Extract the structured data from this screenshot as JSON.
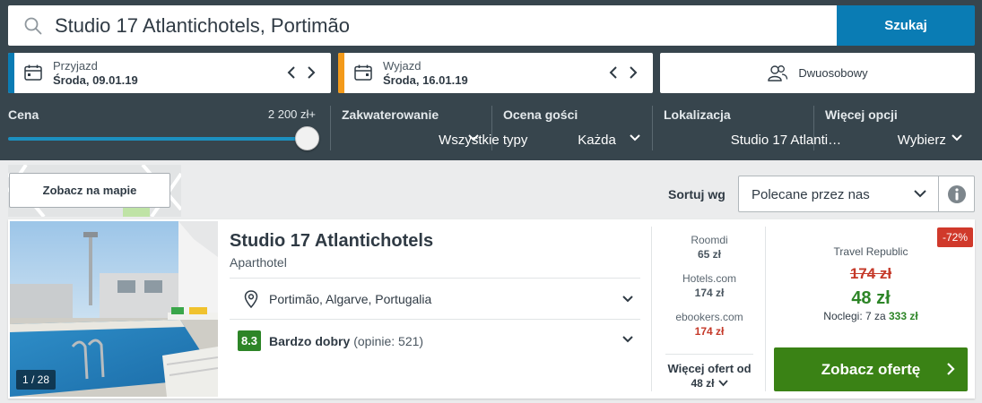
{
  "search": {
    "query": "Studio 17 Atlantichotels, Portimão",
    "button_label": "Szukaj"
  },
  "dates": {
    "checkin": {
      "label": "Przyjazd",
      "value": "Środa, 09.01.19"
    },
    "checkout": {
      "label": "Wyjazd",
      "value": "Środa, 16.01.19"
    }
  },
  "room": {
    "label": "Dwuosobowy"
  },
  "filters": {
    "price": {
      "title": "Cena",
      "max": "2 200 zł+"
    },
    "accommodation": {
      "title": "Zakwaterowanie",
      "value": "Wszystkie typy"
    },
    "rating": {
      "title": "Ocena gości",
      "value": "Każda"
    },
    "location": {
      "title": "Lokalizacja",
      "value": "Studio 17 Atlanti…"
    },
    "more": {
      "title": "Więcej opcji",
      "value": "Wybierz"
    }
  },
  "map": {
    "button_label": "Zobacz na mapie"
  },
  "sort": {
    "label": "Sortuj wg",
    "value": "Polecane przez nas"
  },
  "hotel": {
    "name": "Studio 17 Atlantichotels",
    "type": "Aparthotel",
    "location": "Portimão, Algarve, Portugalia",
    "rating_score": "8.3",
    "rating_label": "Bardzo dobry",
    "rating_count": "(opinie: 521)",
    "photo_counter": "1 / 28",
    "deals": [
      {
        "name": "Roomdi",
        "price": "65 zł"
      },
      {
        "name": "Hotels.com",
        "price": "174 zł"
      },
      {
        "name": "ebookers.com",
        "price": "174 zł"
      }
    ],
    "more_offers_label": "Więcej ofert od",
    "more_offers_price": "48 zł",
    "best": {
      "discount": "-72%",
      "provider": "Travel Republic",
      "old_price": "174 zł",
      "price": "48 zł",
      "nights_prefix": "Noclegi: 7 za ",
      "nights_total": "333 zł",
      "cta_label": "Zobacz ofertę"
    }
  },
  "colors": {
    "topbar": "#37454d",
    "search_button": "#0a7cb4",
    "checkin_strip": "#0a7cb4",
    "checkout_strip": "#f39a1a",
    "rating_badge": "#2d8527",
    "cta": "#3a8215",
    "discount": "#d0392b"
  }
}
